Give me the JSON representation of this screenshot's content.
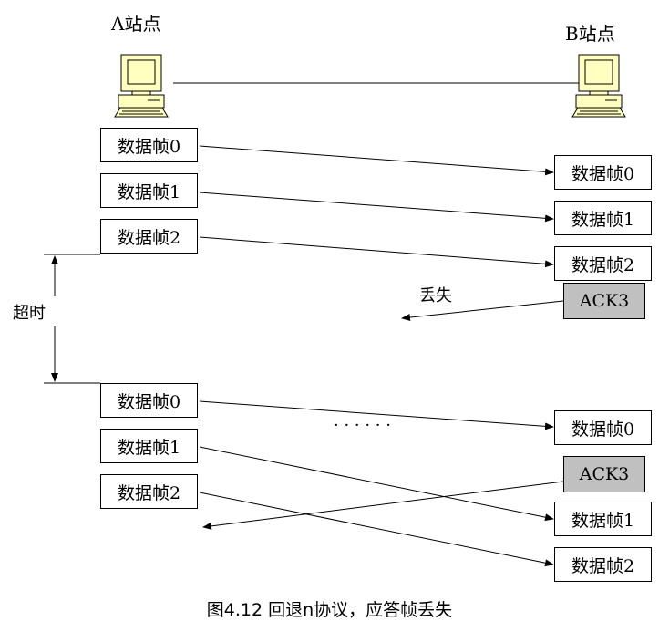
{
  "station_a": "A站点",
  "station_b": "B站点",
  "frames": [
    "数据帧0",
    "数据帧1",
    "数据帧2"
  ],
  "ack": "ACK3",
  "lost": "丢失",
  "timeout": "超时",
  "ellipsis": "· · · · · ·",
  "caption": "图4.12 回退n协议，应答帧丢失"
}
